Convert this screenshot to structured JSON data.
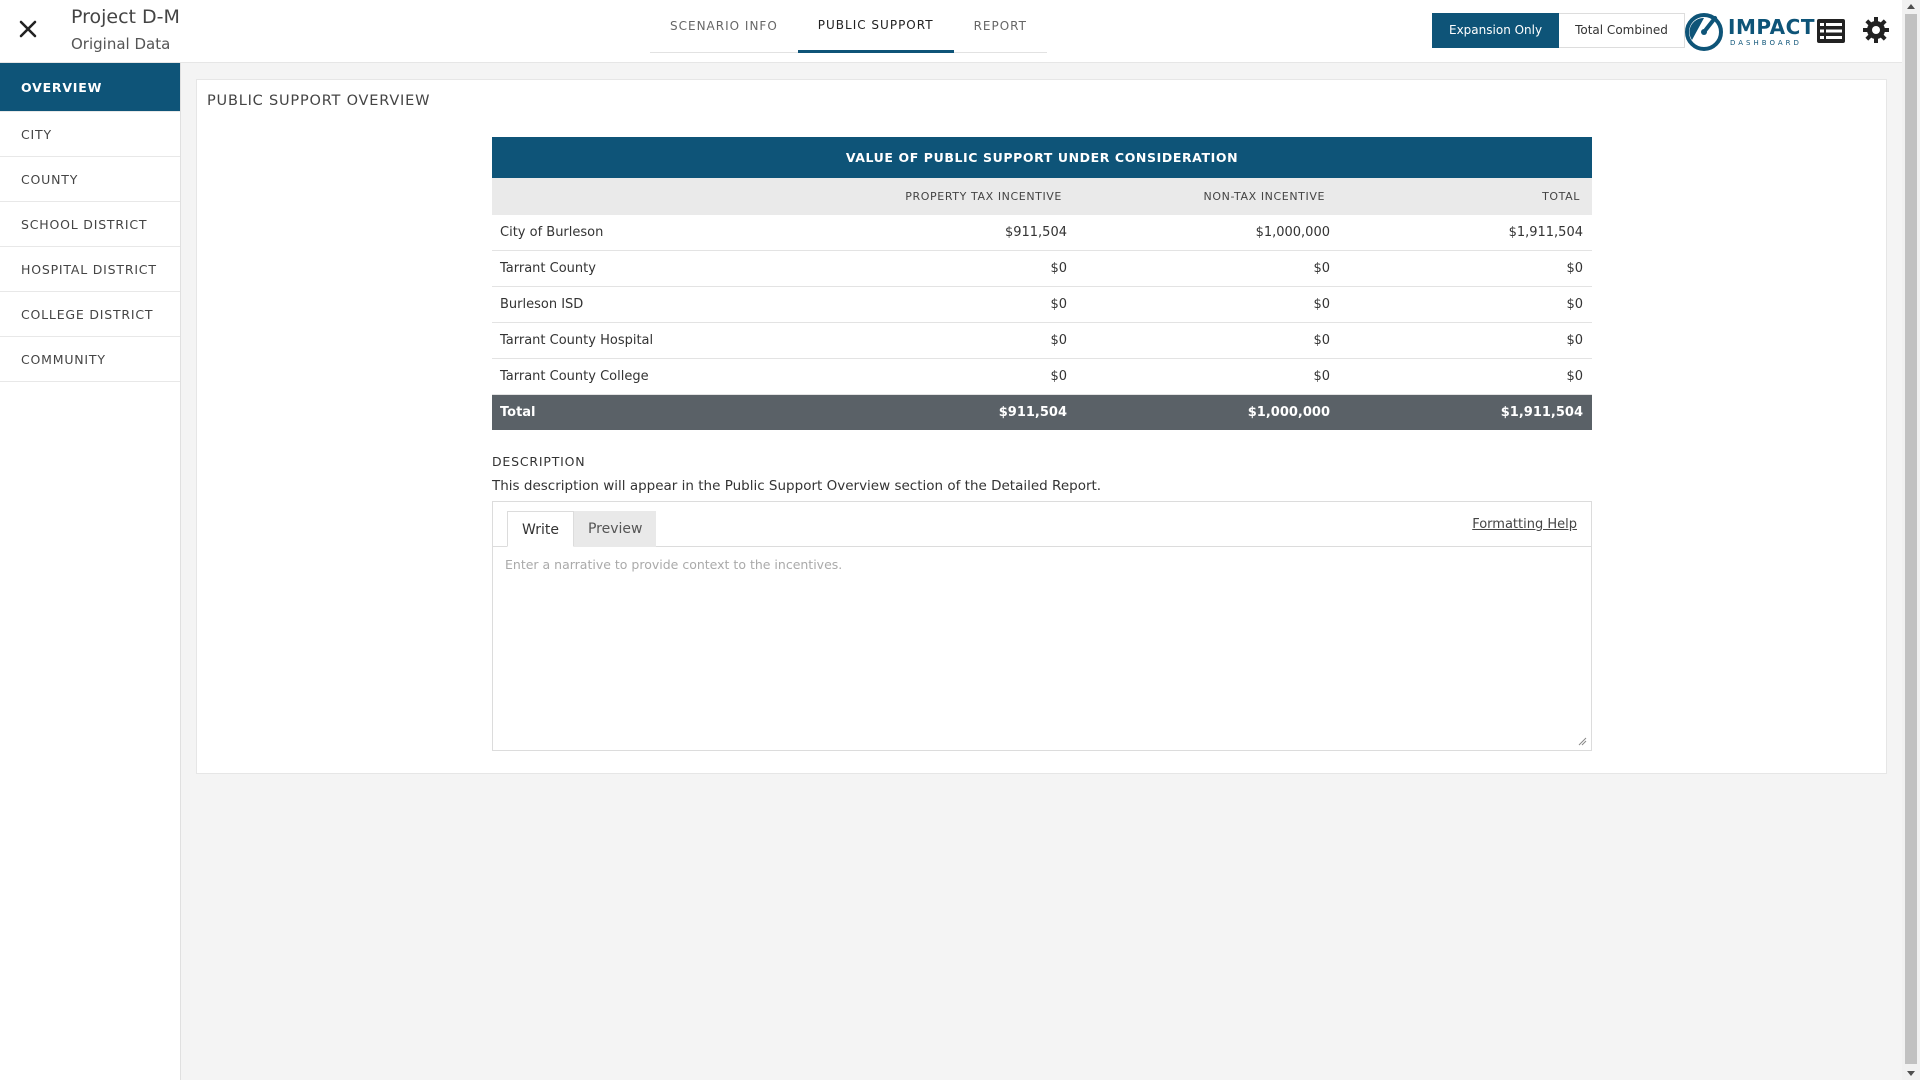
{
  "header": {
    "project_title": "Project D-M",
    "project_subtitle": "Original Data",
    "tabs": [
      {
        "label": "SCENARIO INFO"
      },
      {
        "label": "PUBLIC SUPPORT"
      },
      {
        "label": "REPORT"
      }
    ],
    "active_tab": "PUBLIC SUPPORT",
    "toggle": {
      "expansion_only": "Expansion Only",
      "total_combined": "Total Combined",
      "active": "Expansion Only"
    },
    "logo": {
      "word": "IMPACT",
      "sub": "DASHBOARD"
    },
    "icons": {
      "close": "close-icon",
      "list": "list-icon",
      "settings": "gear-icon"
    }
  },
  "sidebar": {
    "items": [
      {
        "label": "OVERVIEW"
      },
      {
        "label": "CITY"
      },
      {
        "label": "COUNTY"
      },
      {
        "label": "SCHOOL DISTRICT"
      },
      {
        "label": "HOSPITAL DISTRICT"
      },
      {
        "label": "COLLEGE DISTRICT"
      },
      {
        "label": "COMMUNITY"
      }
    ],
    "active": "OVERVIEW"
  },
  "main": {
    "title": "PUBLIC SUPPORT OVERVIEW",
    "table": {
      "heading": "VALUE OF PUBLIC SUPPORT UNDER CONSIDERATION",
      "columns": [
        "",
        "PROPERTY TAX INCENTIVE",
        "NON-TAX INCENTIVE",
        "TOTAL"
      ],
      "rows": [
        [
          "City of Burleson",
          "$911,504",
          "$1,000,000",
          "$1,911,504"
        ],
        [
          "Tarrant County",
          "$0",
          "$0",
          "$0"
        ],
        [
          "Burleson ISD",
          "$0",
          "$0",
          "$0"
        ],
        [
          "Tarrant County Hospital",
          "$0",
          "$0",
          "$0"
        ],
        [
          "Tarrant County College",
          "$0",
          "$0",
          "$0"
        ]
      ],
      "total": [
        "Total",
        "$911,504",
        "$1,000,000",
        "$1,911,504"
      ]
    },
    "description": {
      "label": "DESCRIPTION",
      "help": "This description will appear in the Public Support Overview section of the Detailed Report.",
      "tabs": {
        "write": "Write",
        "preview": "Preview"
      },
      "formatting_help": "Formatting Help",
      "placeholder": "Enter a narrative to provide context to the incentives.",
      "value": ""
    }
  },
  "colors": {
    "brand": "#0e5478",
    "total_row": "#5a6167",
    "background": "#f4f4f4"
  }
}
